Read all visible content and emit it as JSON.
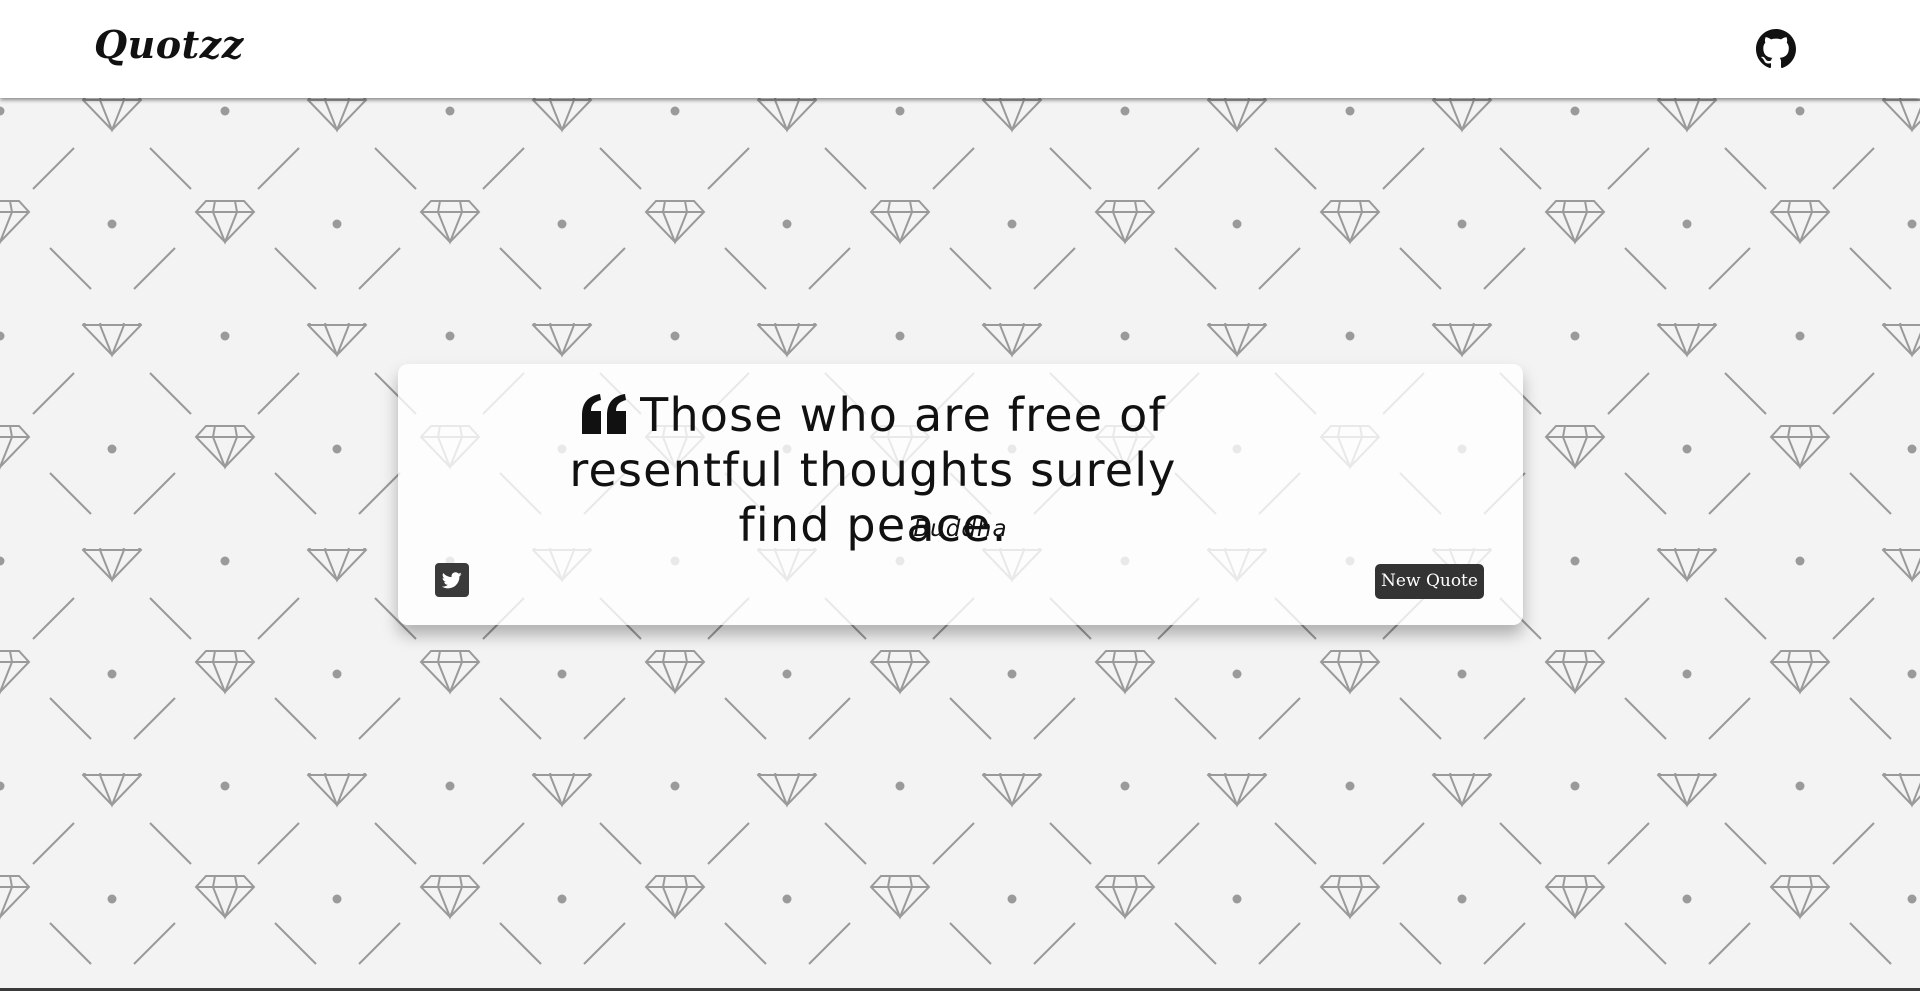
{
  "app": {
    "brand": "Quotzz"
  },
  "nav": {
    "github_icon": "github-icon"
  },
  "quote": {
    "text": "Those who are free of resentful thoughts surely find peace.",
    "author": "Buddha",
    "quote_icon": "quote-left-icon"
  },
  "actions": {
    "tweet_icon": "twitter-icon",
    "new_quote_label": "New Quote"
  },
  "colors": {
    "navbar_bg": "#ffffff",
    "page_bg": "#f3f3f3",
    "pattern_stroke": "#9a9a9a",
    "button_bg": "#333333",
    "button_text": "#ffffff",
    "text": "#111111"
  }
}
